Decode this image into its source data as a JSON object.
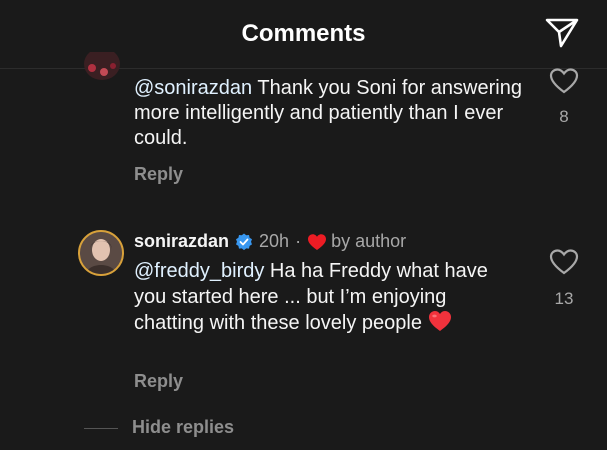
{
  "header": {
    "title": "Comments"
  },
  "comments": [
    {
      "mention": "@sonirazdan",
      "text": " Thank you Soni for answering more intelligently and patiently than I ever could.",
      "reply_label": "Reply",
      "likes": "8"
    },
    {
      "username": "sonirazdan",
      "time": "20h",
      "separator": "·",
      "by_author": "by author",
      "mention": "@freddy_birdy",
      "text": " Ha ha Freddy what have you started here ... but I’m enjoying chatting with these lovely people",
      "reply_label": "Reply",
      "likes": "13"
    }
  ],
  "thread": {
    "hide_replies_label": "Hide replies"
  },
  "colors": {
    "background": "#1a1a1a",
    "heart_red": "#ed1c24",
    "verified_blue": "#3897f0"
  },
  "icons": [
    "share-icon",
    "like-icon",
    "verified-badge-icon",
    "heart-icon"
  ]
}
